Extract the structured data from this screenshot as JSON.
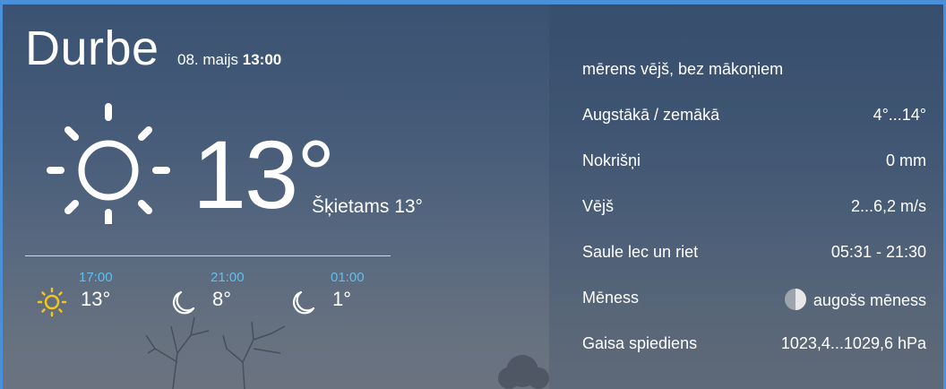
{
  "location": {
    "city": "Durbe",
    "date": "08. maijs",
    "time": "13:00"
  },
  "current": {
    "icon": "sun-icon",
    "temperature": "13°",
    "feels_like": "Šķietams 13°"
  },
  "forecast": [
    {
      "time": "17:00",
      "icon": "sun-icon",
      "temperature": "13°"
    },
    {
      "time": "21:00",
      "icon": "moon-icon",
      "temperature": "8°"
    },
    {
      "time": "01:00",
      "icon": "moon-icon",
      "temperature": "1°"
    }
  ],
  "details": {
    "condition": "mērens vējš, bez mākoņiem",
    "rows": [
      {
        "label": "Augstākā / zemākā",
        "value": "4°...14°"
      },
      {
        "label": "Nokrišņi",
        "value": "0 mm"
      },
      {
        "label": "Vējš",
        "value": "2...6,2 m/s"
      },
      {
        "label": "Saule lec un riet",
        "value": "05:31 - 21:30"
      },
      {
        "label": "Mēness",
        "value": "augošs mēness",
        "icon": "moon-phase-icon"
      },
      {
        "label": "Gaisa spiediens",
        "value": "1023,4...1029,6 hPa"
      }
    ]
  },
  "colors": {
    "accent_border": "#4a90d9",
    "forecast_time": "#5ec0f0",
    "forecast_sun": "#f5c518",
    "text": "#ffffff"
  }
}
